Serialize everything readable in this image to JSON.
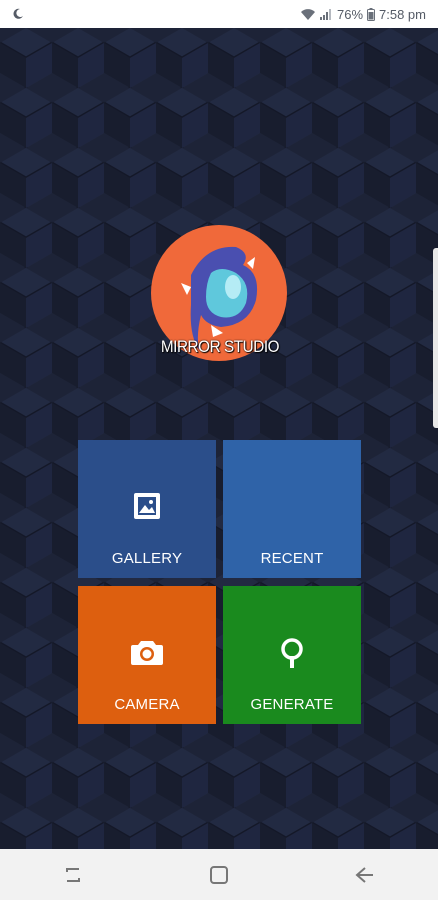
{
  "status_bar": {
    "battery": "76%",
    "time": "7:58 pm",
    "icons": [
      "moon-icon",
      "wifi-icon",
      "signal-icon",
      "battery-icon"
    ]
  },
  "logo": {
    "text": "MIRROR STUDIO",
    "colors": {
      "circle": "#f0693a",
      "drop": "#5fc8dc",
      "swirl": "#4a4fb0"
    }
  },
  "tiles": [
    {
      "label": "GALLERY",
      "icon": "image-icon",
      "color": "#2b4e8a"
    },
    {
      "label": "RECENT",
      "icon": "",
      "color": "#2f63a8"
    },
    {
      "label": "CAMERA",
      "icon": "camera-icon",
      "color": "#dd5f0f"
    },
    {
      "label": "GENERATE",
      "icon": "tree-icon",
      "color": "#1a8a1e"
    }
  ],
  "nav_bar": {
    "buttons": [
      "recents-icon",
      "home-icon",
      "back-icon"
    ]
  }
}
